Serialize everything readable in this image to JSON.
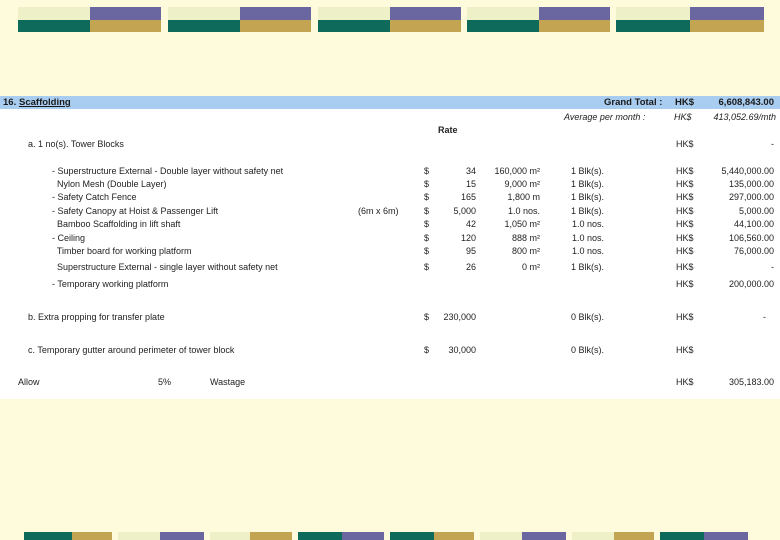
{
  "header": {
    "section_no": "16.",
    "section_title": "Scaffolding",
    "grand_total_label": "Grand Total :",
    "grand_total_currency": "HK$",
    "grand_total_value": "6,608,843.00",
    "avg_label": "Average per month :",
    "avg_currency": "HK$",
    "avg_value": "413,052.69/mth",
    "rate_header": "Rate"
  },
  "section_a": {
    "label": "a.   1   no(s). Tower Blocks",
    "currency": "HK$",
    "value": "-"
  },
  "items": [
    {
      "desc": "- Superstructure External - Double layer without safety net",
      "cur": "$",
      "rate": "34",
      "qty": "160,000 m²",
      "mult": "1 Blk(s).",
      "hk": "HK$",
      "amount": "5,440,000.00",
      "note": ""
    },
    {
      "desc": "  Nylon Mesh (Double Layer)",
      "cur": "$",
      "rate": "15",
      "qty": "9,000 m²",
      "mult": "1 Blk(s).",
      "hk": "HK$",
      "amount": "135,000.00",
      "note": ""
    },
    {
      "desc": "- Safety Catch Fence",
      "cur": "$",
      "rate": "165",
      "qty": "1,800 m",
      "mult": "1 Blk(s).",
      "hk": "HK$",
      "amount": "297,000.00",
      "note": ""
    },
    {
      "desc": "- Safety Canopy at Hoist & Passenger Lift",
      "cur": "$",
      "rate": "5,000",
      "qty": "1.0 nos.",
      "mult": "1 Blk(s).",
      "hk": "HK$",
      "amount": "5,000.00",
      "note": "(6m x 6m)"
    },
    {
      "desc": "  Bamboo Scaffolding in lift shaft",
      "cur": "$",
      "rate": "42",
      "qty": "1,050 m²",
      "mult": "1.0 nos.",
      "hk": "HK$",
      "amount": "44,100.00",
      "note": ""
    },
    {
      "desc": "- Ceiling",
      "cur": "$",
      "rate": "120",
      "qty": "888 m²",
      "mult": "1.0 nos.",
      "hk": "HK$",
      "amount": "106,560.00",
      "note": ""
    },
    {
      "desc": "  Timber board for working platform",
      "cur": "$",
      "rate": "95",
      "qty": "800 m²",
      "mult": "1.0 nos.",
      "hk": "HK$",
      "amount": "76,000.00",
      "note": ""
    },
    {
      "desc": "  Superstructure External - single layer without safety net",
      "cur": "$",
      "rate": "26",
      "qty": "0 m²",
      "mult": "1 Blk(s).",
      "hk": "HK$",
      "amount": "-",
      "note": ""
    }
  ],
  "temp_platform": {
    "label": "- Temporary working platform",
    "currency": "HK$",
    "value": "200,000.00"
  },
  "section_b": {
    "label": "b. Extra propping for transfer plate",
    "cur": "$",
    "rate": "230,000",
    "mult": "0 Blk(s).",
    "hk": "HK$",
    "value": "-"
  },
  "section_c": {
    "label": "c. Temporary gutter around perimeter of tower block",
    "cur": "$",
    "rate": "30,000",
    "mult": "0 Blk(s).",
    "hk": "HK$",
    "value": ""
  },
  "allow": {
    "label": "Allow",
    "pct": "5%",
    "desc": "Wastage",
    "hk": "HK$",
    "value": "305,183.00"
  },
  "palette": {
    "cream": "#eef0c8",
    "purple": "#6a66a0",
    "teal": "#0e6b5c",
    "gold": "#c3a452",
    "title_bar": "#a9cdf0",
    "page_bg": "#fdfbdc"
  }
}
